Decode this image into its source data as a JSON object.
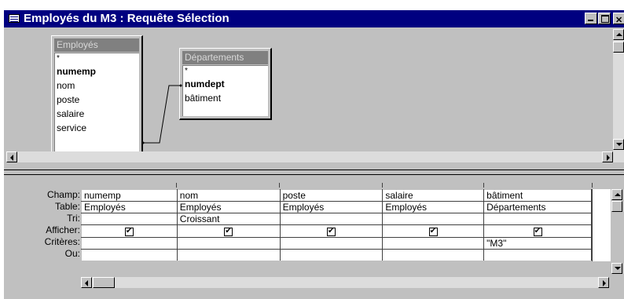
{
  "window": {
    "title": "Employés du M3 : Requête Sélection"
  },
  "tables": [
    {
      "name": "Employés",
      "fields": [
        "*",
        "numemp",
        "nom",
        "poste",
        "salaire",
        "service"
      ],
      "key": "numemp"
    },
    {
      "name": "Départements",
      "fields": [
        "*",
        "numdept",
        "bâtiment"
      ],
      "key": "numdept"
    }
  ],
  "grid": {
    "row_labels": [
      "Champ:",
      "Table:",
      "Tri:",
      "Afficher:",
      "Critères:",
      "Ou:"
    ],
    "columns": [
      {
        "champ": "numemp",
        "table": "Employés",
        "tri": "",
        "afficher": true,
        "criteres": "",
        "ou": ""
      },
      {
        "champ": "nom",
        "table": "Employés",
        "tri": "Croissant",
        "afficher": true,
        "criteres": "",
        "ou": ""
      },
      {
        "champ": "poste",
        "table": "Employés",
        "tri": "",
        "afficher": true,
        "criteres": "",
        "ou": ""
      },
      {
        "champ": "salaire",
        "table": "Employés",
        "tri": "",
        "afficher": true,
        "criteres": "",
        "ou": ""
      },
      {
        "champ": "bâtiment",
        "table": "Départements",
        "tri": "",
        "afficher": true,
        "criteres": "\"M3\"",
        "ou": ""
      }
    ]
  },
  "colors": {
    "title_bar": "#000080",
    "face": "#c0c0c0",
    "table_header": "#808080"
  }
}
